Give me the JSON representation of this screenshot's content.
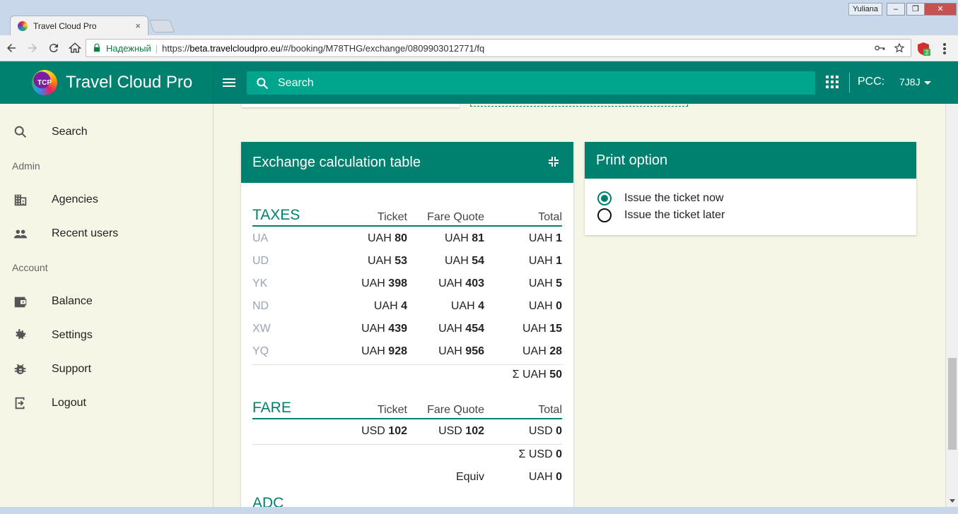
{
  "browser": {
    "tab_title": "Travel Cloud Pro",
    "tab_close": "×",
    "user_badge": "Yuliana",
    "win_minimize": "–",
    "win_restore": "❐",
    "win_close": "✕",
    "secure_label": "Надежный",
    "url_scheme": "https://",
    "url_host": "beta.travelcloudpro.eu",
    "url_path": "/#/booking/M78THG/exchange/0809903012771/fq",
    "extension_badge": "2"
  },
  "header": {
    "brand_name": "Travel Cloud Pro",
    "logo_text": "TCP",
    "search_placeholder": "Search",
    "pcc_label": "PCC:",
    "pcc_value": "7J8J"
  },
  "sidebar": {
    "search": "Search",
    "admin_section": "Admin",
    "agencies": "Agencies",
    "recent_users": "Recent users",
    "account_section": "Account",
    "balance": "Balance",
    "settings": "Settings",
    "support": "Support",
    "logout": "Logout"
  },
  "exchange": {
    "title": "Exchange calculation table",
    "taxes": {
      "title": "TAXES",
      "col_ticket": "Ticket",
      "col_fare_quote": "Fare Quote",
      "col_total": "Total",
      "rows": [
        {
          "code": "UA",
          "ticket_cur": "UAH",
          "ticket": "80",
          "fq_cur": "UAH",
          "fq": "81",
          "total_cur": "UAH",
          "total": "1"
        },
        {
          "code": "UD",
          "ticket_cur": "UAH",
          "ticket": "53",
          "fq_cur": "UAH",
          "fq": "54",
          "total_cur": "UAH",
          "total": "1"
        },
        {
          "code": "YK",
          "ticket_cur": "UAH",
          "ticket": "398",
          "fq_cur": "UAH",
          "fq": "403",
          "total_cur": "UAH",
          "total": "5"
        },
        {
          "code": "ND",
          "ticket_cur": "UAH",
          "ticket": "4",
          "fq_cur": "UAH",
          "fq": "4",
          "total_cur": "UAH",
          "total": "0"
        },
        {
          "code": "XW",
          "ticket_cur": "UAH",
          "ticket": "439",
          "fq_cur": "UAH",
          "fq": "454",
          "total_cur": "UAH",
          "total": "15"
        },
        {
          "code": "YQ",
          "ticket_cur": "UAH",
          "ticket": "928",
          "fq_cur": "UAH",
          "fq": "956",
          "total_cur": "UAH",
          "total": "28"
        }
      ],
      "sum_prefix": "Σ  UAH",
      "sum_value": "50"
    },
    "fare": {
      "title": "FARE",
      "col_ticket": "Ticket",
      "col_fare_quote": "Fare Quote",
      "col_total": "Total",
      "ticket_cur": "USD",
      "ticket": "102",
      "fq_cur": "USD",
      "fq": "102",
      "total_cur": "USD",
      "total": "0",
      "sum_prefix": "Σ  USD",
      "sum_value": "0",
      "equiv_label": "Equiv",
      "equiv_cur": "UAH",
      "equiv_value": "0"
    },
    "next_section_partial": "ADC"
  },
  "print_option": {
    "title": "Print option",
    "option_now": "Issue the ticket now",
    "option_later": "Issue the ticket later",
    "selected": "now"
  },
  "colors": {
    "brand": "#00806f",
    "search_bg": "#00a58d",
    "page_bg": "#f5f6e6"
  }
}
